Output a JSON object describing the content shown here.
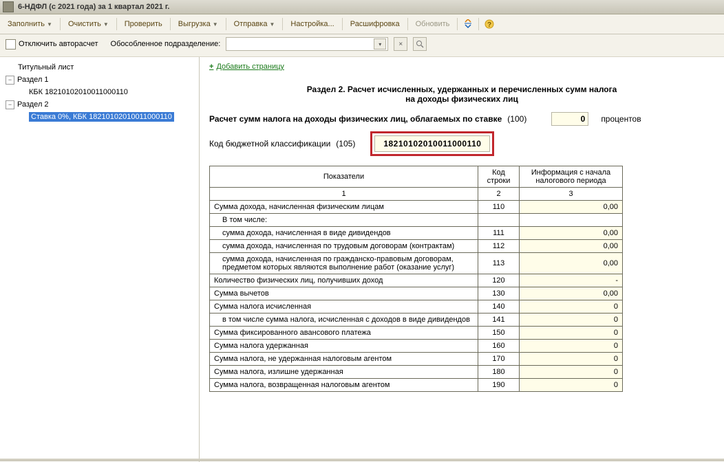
{
  "window": {
    "title": "6-НДФЛ (с 2021 года) за 1 квартал 2021 г."
  },
  "toolbar": {
    "fill": "Заполнить",
    "clear": "Очистить",
    "check": "Проверить",
    "export": "Выгрузка",
    "send": "Отправка",
    "settings": "Настройка...",
    "decode": "Расшифровка",
    "refresh": "Обновить"
  },
  "opts": {
    "disable_autocalc": "Отключить авторасчет",
    "subdivision_label": "Обособленное подразделение:",
    "subdivision_value": ""
  },
  "tree": {
    "root": "Титульный лист",
    "sec1": "Раздел 1",
    "sec1_kbk": "КБК 18210102010011000110",
    "sec2": "Раздел 2",
    "sec2_item": "Ставка 0%, КБК 18210102010011000110"
  },
  "content": {
    "add_page": "Добавить страницу",
    "title_line1": "Раздел 2. Расчет исчисленных, удержанных и перечисленных сумм налога",
    "title_line2": "на доходы физических лиц",
    "rate_label": "Расчет сумм налога на доходы физических лиц, облагаемых по ставке",
    "rate_code": "(100)",
    "rate_value": "0",
    "rate_unit": "процентов",
    "kbk_label": "Код бюджетной классификации",
    "kbk_code": "(105)",
    "kbk_value": "18210102010011000110",
    "headers": {
      "col1": "Показатели",
      "col2": "Код строки",
      "col3": "Информация с начала налогового периода",
      "n1": "1",
      "n2": "2",
      "n3": "3"
    },
    "rows": [
      {
        "label": "Сумма дохода, начисленная физическим лицам",
        "code": "110",
        "value": "0,00",
        "indent": false
      },
      {
        "label": "В том числе:",
        "code": "",
        "value": "",
        "indent": true,
        "blankValue": true
      },
      {
        "label": "сумма дохода, начисленная в виде дивидендов",
        "code": "111",
        "value": "0,00",
        "indent": true
      },
      {
        "label": "сумма дохода, начисленная по трудовым договорам (контрактам)",
        "code": "112",
        "value": "0,00",
        "indent": true
      },
      {
        "label": "сумма дохода, начисленная по гражданско-правовым договорам, предметом которых являются выполнение работ (оказание услуг)",
        "code": "113",
        "value": "0,00",
        "indent": true
      },
      {
        "label": "Количество физических лиц, получивших доход",
        "code": "120",
        "value": "-",
        "indent": false
      },
      {
        "label": "Сумма вычетов",
        "code": "130",
        "value": "0,00",
        "indent": false
      },
      {
        "label": "Сумма налога исчисленная",
        "code": "140",
        "value": "0",
        "indent": false
      },
      {
        "label": "в том числе сумма налога, исчисленная с доходов в виде дивидендов",
        "code": "141",
        "value": "0",
        "indent": true
      },
      {
        "label": "Сумма фиксированного авансового платежа",
        "code": "150",
        "value": "0",
        "indent": false
      },
      {
        "label": "Сумма налога удержанная",
        "code": "160",
        "value": "0",
        "indent": false
      },
      {
        "label": "Сумма налога, не удержанная налоговым агентом",
        "code": "170",
        "value": "0",
        "indent": false
      },
      {
        "label": "Сумма налога, излишне удержанная",
        "code": "180",
        "value": "0",
        "indent": false
      },
      {
        "label": "Сумма налога, возвращенная налоговым агентом",
        "code": "190",
        "value": "0",
        "indent": false
      }
    ]
  }
}
